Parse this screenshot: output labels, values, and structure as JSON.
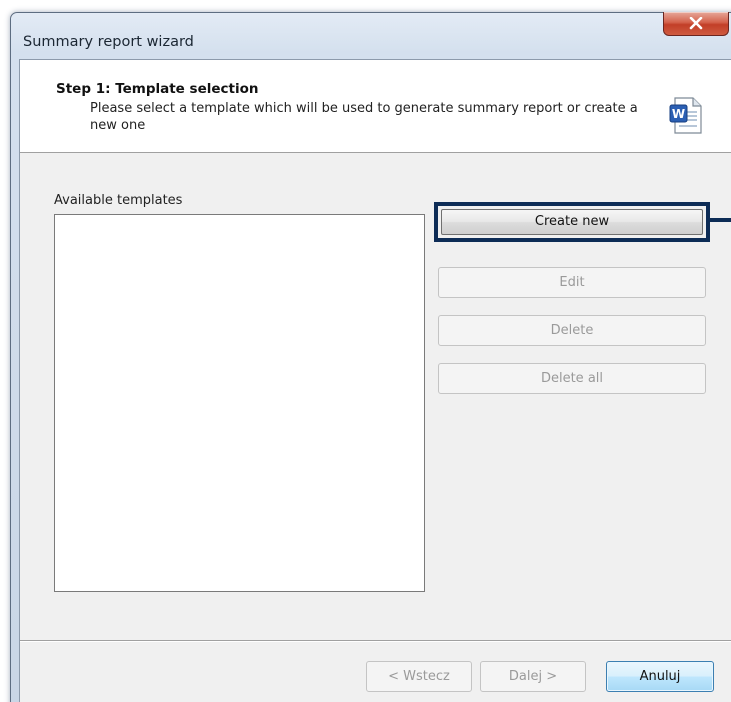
{
  "window": {
    "title": "Summary report wizard",
    "close_glyph": "✕"
  },
  "header": {
    "step_title": "Step 1: Template selection",
    "step_description": "Please select a template which will be used to generate summary report or create a new one",
    "icon": "word-document-icon"
  },
  "templates": {
    "label": "Available templates",
    "items": []
  },
  "actions": {
    "create_new": "Create new",
    "edit": "Edit",
    "delete": "Delete",
    "delete_all": "Delete all"
  },
  "footer": {
    "back": "< Wstecz",
    "next": "Dalej >",
    "cancel": "Anuluj"
  },
  "colors": {
    "callout_border": "#0d2c56",
    "close_button": "#c23f28"
  }
}
